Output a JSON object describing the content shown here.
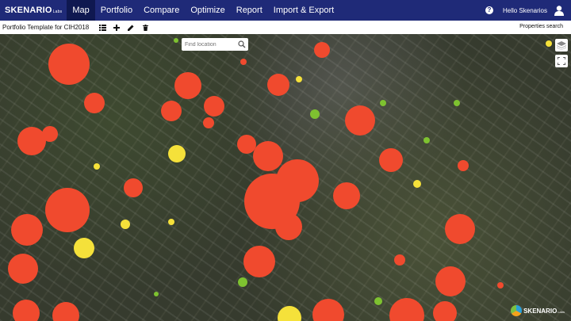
{
  "brand": {
    "name": "SKENARIO",
    "suffix": "Labs"
  },
  "nav": {
    "items": [
      {
        "label": "Map",
        "active": true
      },
      {
        "label": "Portfolio",
        "active": false
      },
      {
        "label": "Compare",
        "active": false
      },
      {
        "label": "Optimize",
        "active": false
      },
      {
        "label": "Report",
        "active": false
      },
      {
        "label": "Import & Export",
        "active": false
      }
    ],
    "help_label": "?",
    "greeting": "Hello Skenarios"
  },
  "toolbar": {
    "title": "Portfolio Template for CIH2018",
    "icons": [
      "list-icon",
      "plus-icon",
      "pencil-icon",
      "trash-icon"
    ],
    "properties_search": "Properties search"
  },
  "map": {
    "search_placeholder": "Find location",
    "controls": [
      "layers-icon",
      "fullscreen-icon"
    ],
    "colors": {
      "high": "#f04a2e",
      "medium": "#f5e13a",
      "low": "#7ec230",
      "nav_bg": "#1f2a78",
      "nav_active": "#0f1850"
    }
  },
  "watermark": {
    "name": "SKENARIO",
    "suffix": "Labs"
  }
}
